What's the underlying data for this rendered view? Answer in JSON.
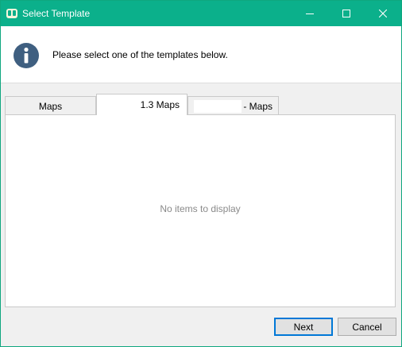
{
  "window": {
    "title": "Select Template",
    "accent_color": "#0bb08b",
    "icons": {
      "app": "app-logo-icon",
      "minimize": "minimize-icon",
      "maximize": "maximize-icon",
      "close": "close-icon",
      "info": "info-icon"
    }
  },
  "header": {
    "message": "Please select one of the templates below."
  },
  "tabs": [
    {
      "label": "Maps",
      "active": false
    },
    {
      "label": "1.3 Maps",
      "active": true
    },
    {
      "label": "- Maps",
      "active": false
    }
  ],
  "content": {
    "empty_message": "No items to display"
  },
  "buttons": {
    "next": "Next",
    "cancel": "Cancel"
  }
}
